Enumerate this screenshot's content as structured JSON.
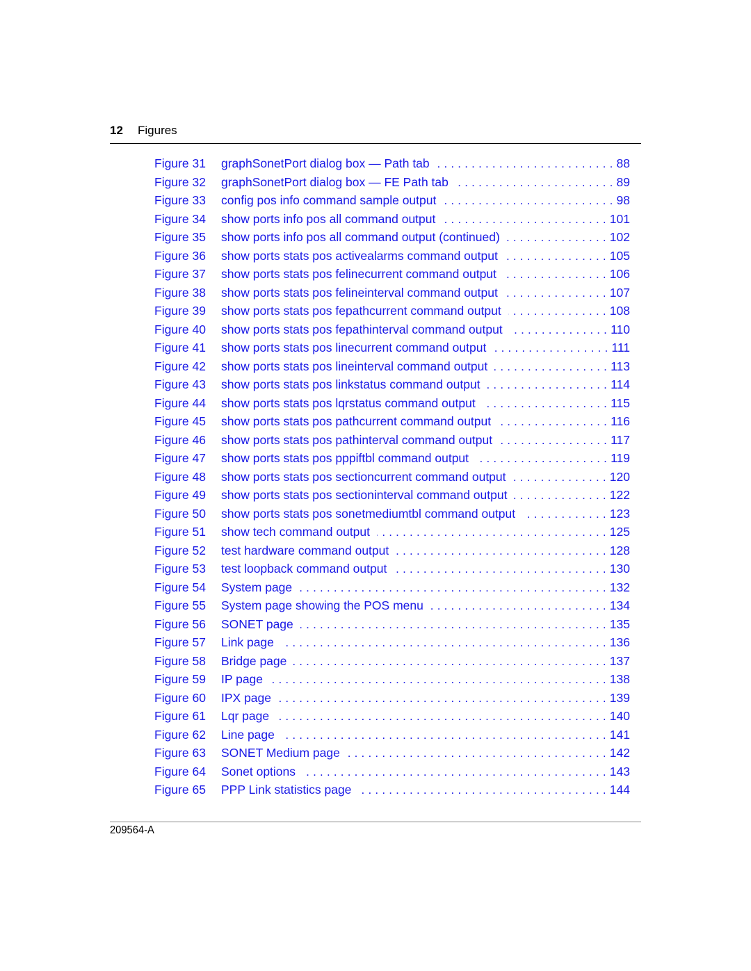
{
  "header": {
    "page_number": "12",
    "section_title": "Figures"
  },
  "link_color": "#1a1ae6",
  "toc": [
    {
      "figure": "Figure 31",
      "title": "graphSonetPort dialog box — Path tab",
      "page": "88"
    },
    {
      "figure": "Figure 32",
      "title": "graphSonetPort dialog box — FE Path tab",
      "page": "89"
    },
    {
      "figure": "Figure 33",
      "title": "config pos info command sample output",
      "page": "98"
    },
    {
      "figure": "Figure 34",
      "title": "show ports info pos all command output",
      "page": "101"
    },
    {
      "figure": "Figure 35",
      "title": "show ports info pos all command output (continued)",
      "page": "102"
    },
    {
      "figure": "Figure 36",
      "title": "show ports stats pos activealarms command output",
      "page": "105"
    },
    {
      "figure": "Figure 37",
      "title": "show ports stats pos felinecurrent command output",
      "page": "106"
    },
    {
      "figure": "Figure 38",
      "title": "show ports stats pos felineinterval command output",
      "page": "107"
    },
    {
      "figure": "Figure 39",
      "title": "show ports stats pos fepathcurrent command output",
      "page": "108"
    },
    {
      "figure": "Figure 40",
      "title": "show ports stats pos fepathinterval command output",
      "page": "110"
    },
    {
      "figure": "Figure 41",
      "title": "show ports stats pos linecurrent command output",
      "page": "111"
    },
    {
      "figure": "Figure 42",
      "title": "show ports stats pos lineinterval command output",
      "page": "113"
    },
    {
      "figure": "Figure 43",
      "title": "show ports stats pos linkstatus command output",
      "page": "114"
    },
    {
      "figure": "Figure 44",
      "title": "show ports stats pos lqrstatus command output",
      "page": "115"
    },
    {
      "figure": "Figure 45",
      "title": "show ports stats pos pathcurrent command output",
      "page": "116"
    },
    {
      "figure": "Figure 46",
      "title": "show ports stats pos pathinterval command output",
      "page": "117"
    },
    {
      "figure": "Figure 47",
      "title": "show ports stats pos pppiftbl command output",
      "page": "119"
    },
    {
      "figure": "Figure 48",
      "title": "show ports stats pos sectioncurrent command output",
      "page": "120"
    },
    {
      "figure": "Figure 49",
      "title": "show ports stats pos sectioninterval command output",
      "page": "122"
    },
    {
      "figure": "Figure 50",
      "title": "show ports stats pos sonetmediumtbl command output",
      "page": "123"
    },
    {
      "figure": "Figure 51",
      "title": "show tech command output",
      "page": "125"
    },
    {
      "figure": "Figure 52",
      "title": "test hardware command output",
      "page": "128"
    },
    {
      "figure": "Figure 53",
      "title": "test loopback command output",
      "page": "130"
    },
    {
      "figure": "Figure 54",
      "title": "System page",
      "page": "132"
    },
    {
      "figure": "Figure 55",
      "title": "System page showing the POS menu",
      "page": "134"
    },
    {
      "figure": "Figure 56",
      "title": "SONET page",
      "page": "135"
    },
    {
      "figure": "Figure 57",
      "title": "Link page",
      "page": "136"
    },
    {
      "figure": "Figure 58",
      "title": "Bridge page",
      "page": "137"
    },
    {
      "figure": "Figure 59",
      "title": "IP page",
      "page": "138"
    },
    {
      "figure": "Figure 60",
      "title": "IPX page",
      "page": "139"
    },
    {
      "figure": "Figure 61",
      "title": "Lqr page",
      "page": "140"
    },
    {
      "figure": "Figure 62",
      "title": "Line page",
      "page": "141"
    },
    {
      "figure": "Figure 63",
      "title": "SONET Medium page",
      "page": "142"
    },
    {
      "figure": "Figure 64",
      "title": "Sonet options",
      "page": "143"
    },
    {
      "figure": "Figure 65",
      "title": "PPP Link statistics page",
      "page": "144"
    }
  ],
  "footer": {
    "document_code": "209564-A"
  }
}
